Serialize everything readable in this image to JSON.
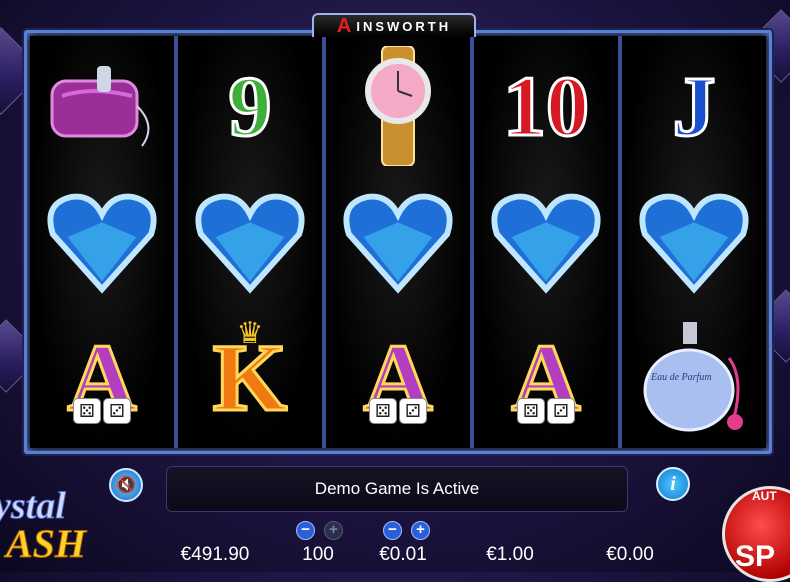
{
  "brand": {
    "logo_mark": "A",
    "name": "INSWORTH"
  },
  "reels": [
    {
      "top": {
        "type": "purse"
      },
      "mid": {
        "type": "heart-diamond"
      },
      "bottom": {
        "type": "letter",
        "text": "A",
        "color": "purple",
        "extra": "dice"
      }
    },
    {
      "top": {
        "type": "number",
        "text": "9",
        "color": "green"
      },
      "mid": {
        "type": "heart-diamond"
      },
      "bottom": {
        "type": "letter",
        "text": "K",
        "color": "orange",
        "extra": "crown"
      }
    },
    {
      "top": {
        "type": "watch"
      },
      "mid": {
        "type": "heart-diamond"
      },
      "bottom": {
        "type": "letter",
        "text": "A",
        "color": "purple",
        "extra": "dice"
      }
    },
    {
      "top": {
        "type": "number",
        "text": "10",
        "color": "red"
      },
      "mid": {
        "type": "heart-diamond"
      },
      "bottom": {
        "type": "letter",
        "text": "A",
        "color": "purple",
        "extra": "dice"
      }
    },
    {
      "top": {
        "type": "number",
        "text": "J",
        "color": "blue"
      },
      "mid": {
        "type": "heart-diamond"
      },
      "bottom": {
        "type": "perfume",
        "text": "Eau de Parfum"
      }
    }
  ],
  "message": "Demo Game Is Active",
  "stats": {
    "cash": "€491.90",
    "lines": "100",
    "bet": "€0.01",
    "total_bet": "€1.00",
    "win": "€0.00"
  },
  "logo": {
    "line1": "ystal",
    "line2": "ASH"
  },
  "autoplay_label": "AUT",
  "spin_label": "SP",
  "colors": {
    "frame": "#5b7fd4",
    "accent": "#e8c200",
    "spin": "#d80000"
  }
}
